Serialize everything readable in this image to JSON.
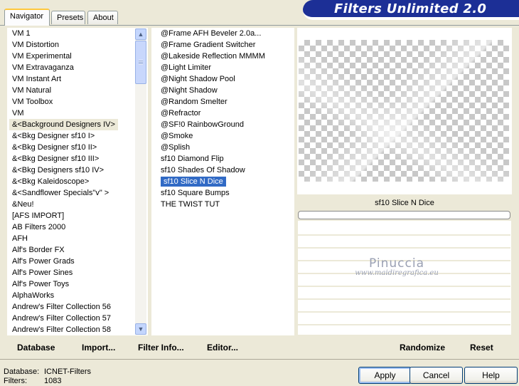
{
  "app": {
    "title": "Filters Unlimited 2.0"
  },
  "tabs": [
    {
      "label": "Navigator",
      "active": true
    },
    {
      "label": "Presets",
      "active": false
    },
    {
      "label": "About",
      "active": false
    }
  ],
  "categories": {
    "items": [
      "VM 1",
      "VM Distortion",
      "VM Experimental",
      "VM Extravaganza",
      "VM Instant Art",
      "VM Natural",
      "VM Toolbox",
      "VM",
      "&<Background Designers IV>",
      "&<Bkg Designer sf10 I>",
      "&<Bkg Designer sf10 II>",
      "&<Bkg Designer sf10 III>",
      "&<Bkg Designers sf10 IV>",
      "&<Bkg Kaleidoscope>",
      "&<Sandflower Specials\"v\" >",
      "&Neu!",
      "[AFS IMPORT]",
      "AB Filters 2000",
      "AFH",
      "Alf's Border FX",
      "Alf's Power Grads",
      "Alf's Power Sines",
      "Alf's Power Toys",
      "AlphaWorks",
      "Andrew's Filter Collection 56",
      "Andrew's Filter Collection 57",
      "Andrew's Filter Collection 58"
    ],
    "selected_index": 8
  },
  "filters": {
    "items": [
      "@Frame AFH Beveler 2.0a...",
      "@Frame Gradient Switcher",
      "@Lakeside Reflection MMMM",
      "@Light Limiter",
      "@Night Shadow Pool",
      "@Night Shadow",
      "@Random Smelter",
      "@Refractor",
      "@SF!0 RainbowGround",
      "@Smoke",
      "@Splish",
      "sf10 Diamond Flip",
      "sf10 Shades Of Shadow",
      "sf10 Slice N Dice",
      "sf10 Square Bumps",
      "THE TWIST TUT"
    ],
    "selected_index": 13
  },
  "preview": {
    "filter_name": "sf10 Slice N Dice",
    "watermark_name": "Pinuccia",
    "watermark_url": "www.maidiregrafica.eu"
  },
  "toolbar": {
    "database_label": "Database",
    "import_label": "Import...",
    "filter_info_label": "Filter Info...",
    "editor_label": "Editor...",
    "randomize_label": "Randomize",
    "reset_label": "Reset"
  },
  "status": {
    "database_label": "Database:",
    "database_value": "ICNET-Filters",
    "filters_label": "Filters:",
    "filters_value": "1083"
  },
  "buttons": {
    "apply": "Apply",
    "cancel": "Cancel",
    "help": "Help"
  },
  "scrollbar": {
    "up_icon": "chevron-up-icon",
    "down_icon": "chevron-down-icon"
  }
}
